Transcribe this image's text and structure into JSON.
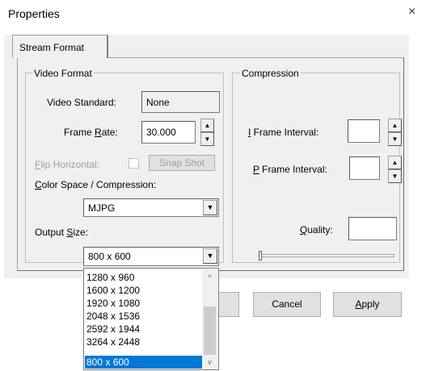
{
  "window": {
    "title": "Properties",
    "close_glyph": "×"
  },
  "tabs": [
    {
      "label": "Stream Format"
    }
  ],
  "video_format": {
    "group_label": "Video Format",
    "video_standard": {
      "label": "Video Standard:",
      "value": "None"
    },
    "frame_rate": {
      "label_pre": "Frame ",
      "label_u": "R",
      "label_post": "ate:",
      "value": "30.000"
    },
    "flip_horizontal": {
      "label_u": "F",
      "label_post": "lip Horizontal:",
      "checked": false
    },
    "snap_shot": {
      "label": "Snap Shot"
    },
    "color_space": {
      "label_u": "C",
      "label_post": "olor Space / Compression:",
      "value": "MJPG"
    },
    "output_size": {
      "label_pre": "Output ",
      "label_u": "S",
      "label_post": "ize:",
      "value": "800 x 600"
    }
  },
  "compression": {
    "group_label": "Compression",
    "i_frame": {
      "label_u": "I",
      "label_post": " Frame Interval:",
      "value": ""
    },
    "p_frame": {
      "label_u": "P",
      "label_post": " Frame Interval:",
      "value": ""
    },
    "quality": {
      "label_u": "Q",
      "label_post": "uality:",
      "value": ""
    }
  },
  "dropdown": {
    "options": [
      "1280 x 960",
      "1600 x 1200",
      "1920 x 1080",
      "2048 x 1536",
      "2592 x 1944",
      "3264 x 2448",
      "800 x 600"
    ],
    "selected": "800 x 600"
  },
  "buttons": {
    "cancel": "Cancel",
    "apply_u": "A",
    "apply_post": "pply"
  },
  "icons": {
    "spin_up": "▲",
    "spin_down": "▼",
    "combo_arrow": "▼",
    "scroll_up": "^",
    "scroll_down": "v"
  },
  "colors": {
    "selection": "#0078d7",
    "dialog_bg": "#f0f0f0"
  }
}
